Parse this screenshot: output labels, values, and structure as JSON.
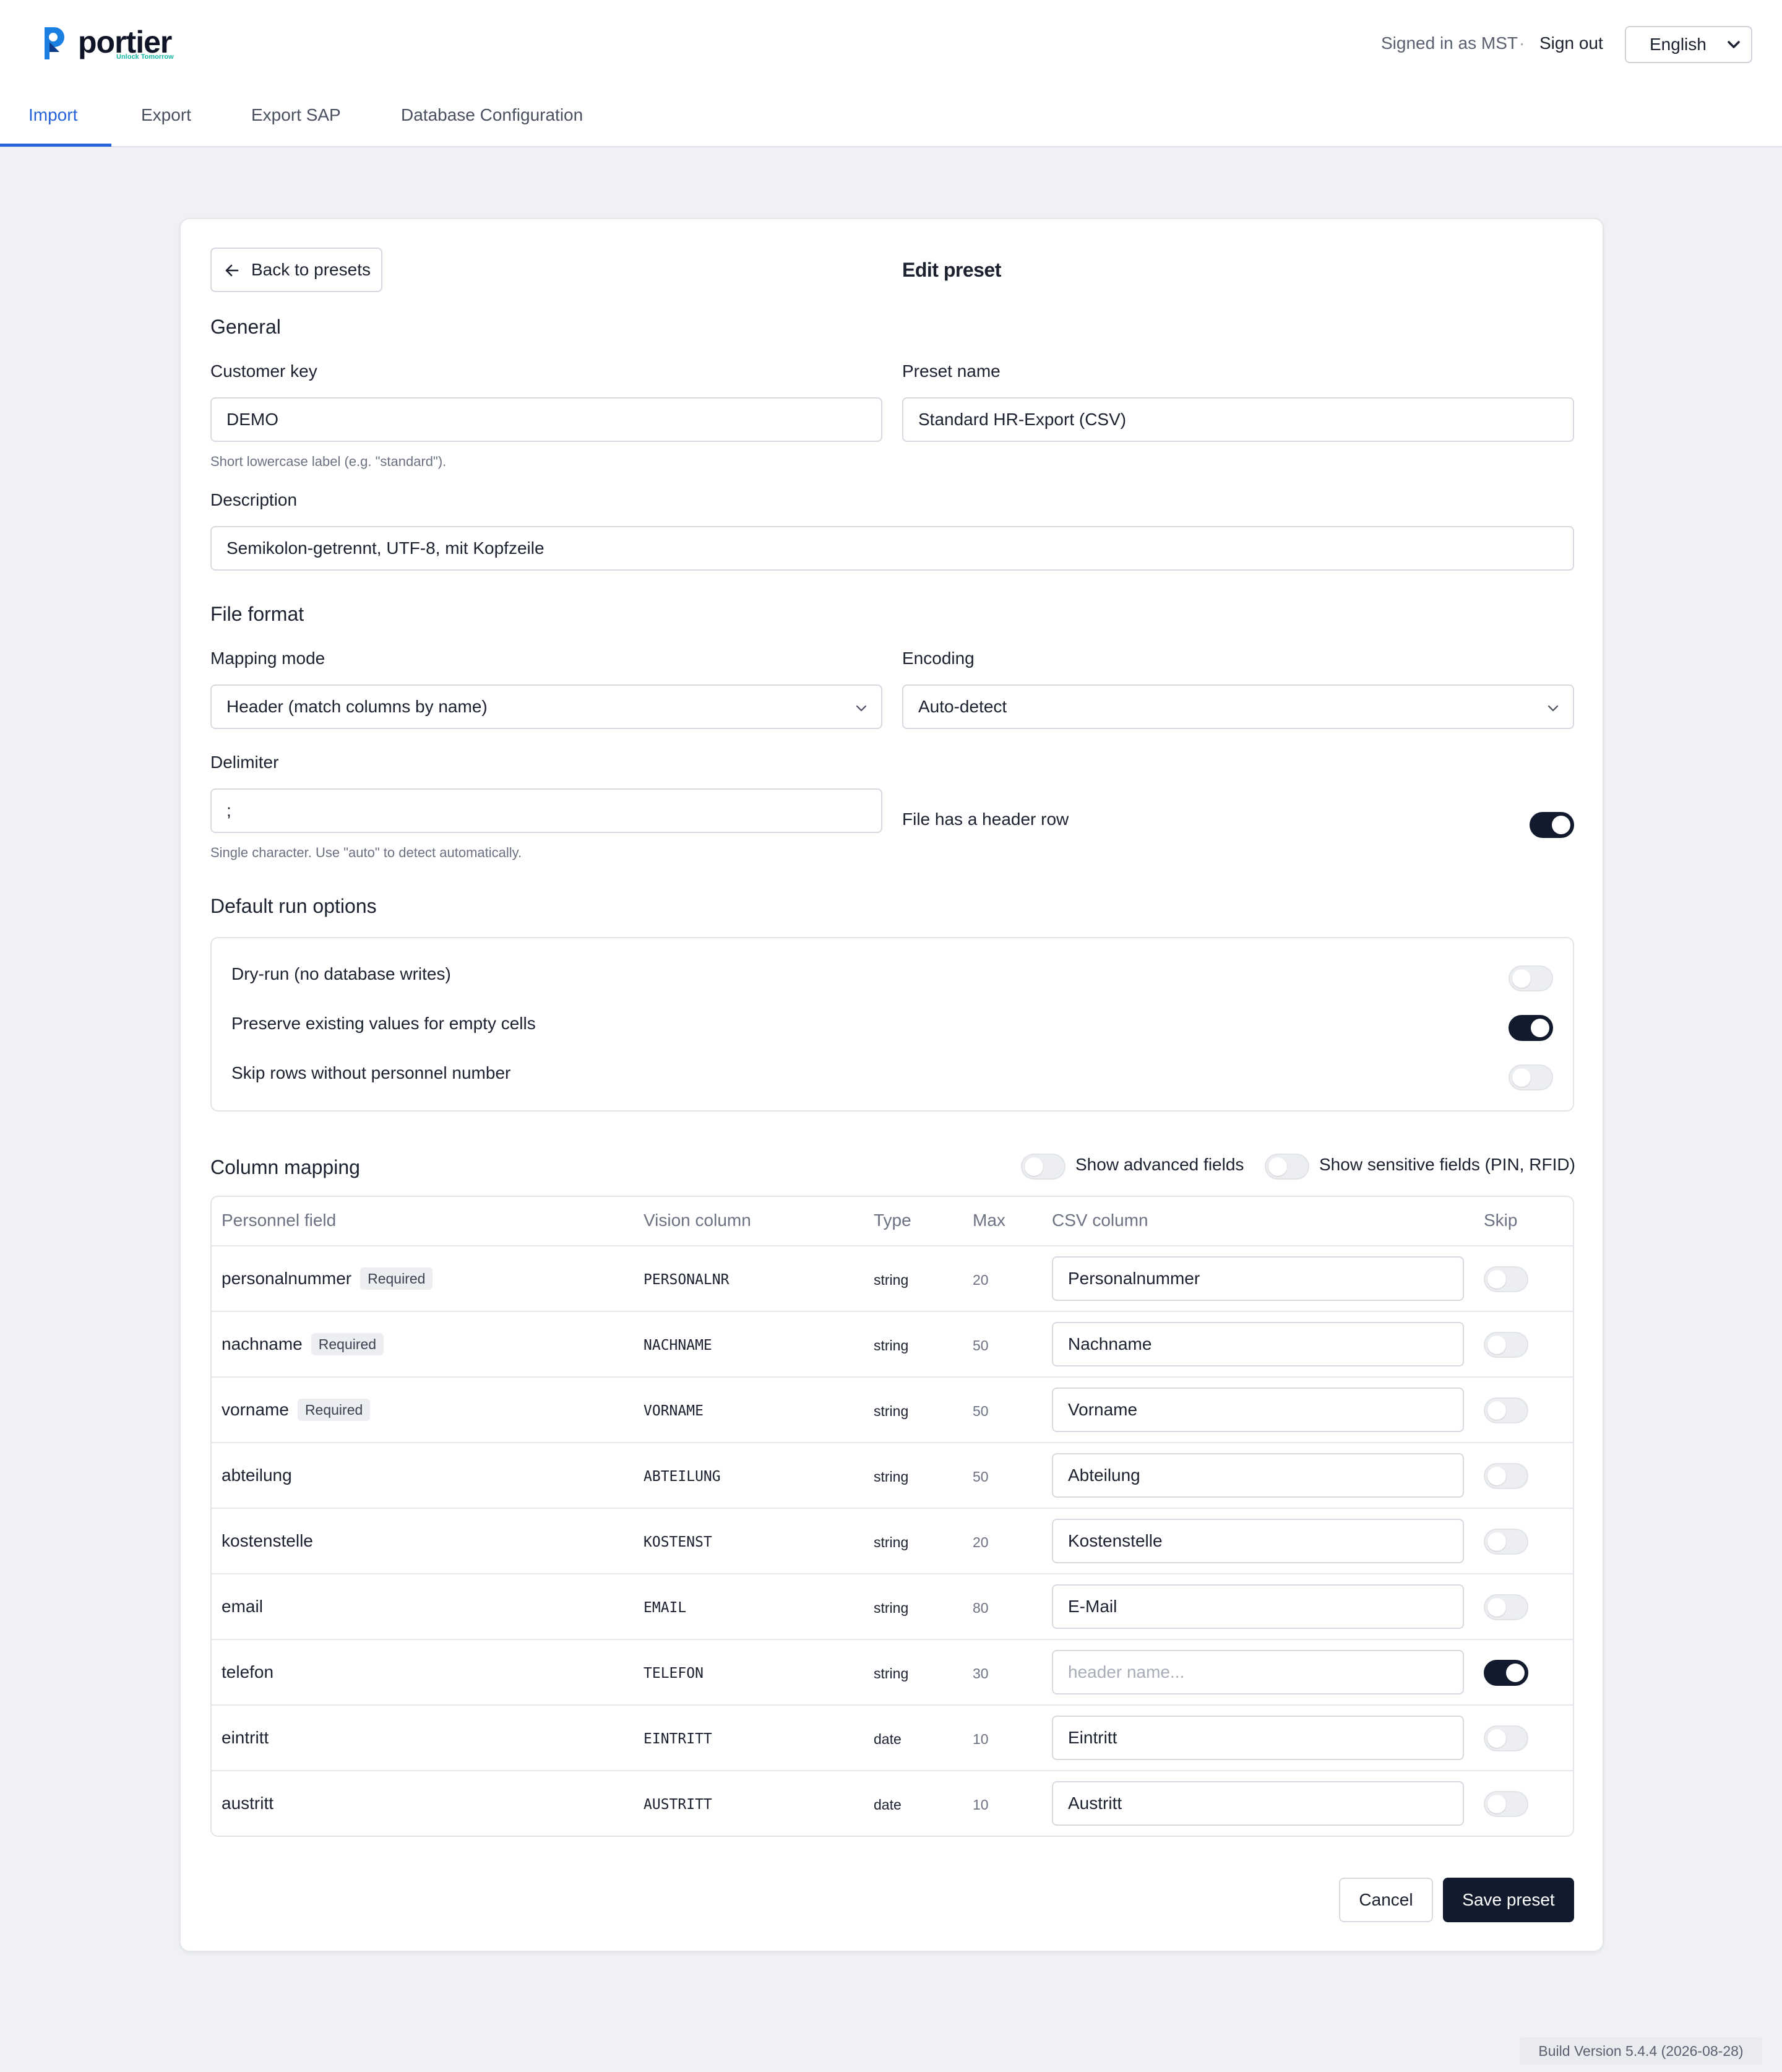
{
  "brand": {
    "name": "portier",
    "tagline": "Unlock Tomorrow",
    "primary_color": "#2563d8",
    "logo_colors": [
      "#1a7fe0",
      "#19b6a7"
    ]
  },
  "header": {
    "signed_in": "Signed in as MST",
    "separator": "·",
    "sign_out": "Sign out",
    "language": "English"
  },
  "tabs": [
    {
      "label": "Import",
      "active": true
    },
    {
      "label": "Export"
    },
    {
      "label": "Export SAP"
    },
    {
      "label": "Database Configuration"
    }
  ],
  "editor": {
    "back_label": "Back to presets",
    "title": "Edit preset",
    "general": {
      "title": "General",
      "customer_key_label": "Customer key",
      "customer_key_value": "DEMO",
      "customer_key_help": "Short lowercase label (e.g. \"standard\").",
      "preset_name_label": "Preset name",
      "preset_name_value": "Standard HR-Export (CSV)",
      "description_label": "Description",
      "description_value": "Semikolon-getrennt, UTF-8, mit Kopfzeile"
    },
    "file_format": {
      "title": "File format",
      "mapping_mode_label": "Mapping mode",
      "mapping_mode_value": "Header (match columns by name)",
      "encoding_label": "Encoding",
      "encoding_value": "Auto-detect",
      "delimiter_label": "Delimiter",
      "delimiter_value": ";",
      "delimiter_help": "Single character. Use \"auto\" to detect automatically.",
      "header_row_label": "File has a header row",
      "header_row_on": true
    },
    "run_options": {
      "title": "Default run options",
      "options": [
        {
          "label": "Dry-run (no database writes)",
          "on": false
        },
        {
          "label": "Preserve existing values for empty cells",
          "on": true
        },
        {
          "label": "Skip rows without personnel number",
          "on": false
        }
      ]
    },
    "column_mapping": {
      "title": "Column mapping",
      "show_advanced_label": "Show advanced fields",
      "show_advanced_on": false,
      "show_sensitive_label": "Show sensitive fields (PIN, RFID)",
      "show_sensitive_on": false,
      "headers": {
        "field": "Personnel field",
        "vision": "Vision column",
        "type": "Type",
        "max": "Max",
        "csv": "CSV column",
        "skip": "Skip"
      },
      "required_badge": "Required",
      "csv_placeholder": "header name...",
      "rows": [
        {
          "field": "personalnummer",
          "required": true,
          "vision": "PERSONALNR",
          "type": "string",
          "max": "20",
          "csv": "Personalnummer",
          "skip": false
        },
        {
          "field": "nachname",
          "required": true,
          "vision": "NACHNAME",
          "type": "string",
          "max": "50",
          "csv": "Nachname",
          "skip": false
        },
        {
          "field": "vorname",
          "required": true,
          "vision": "VORNAME",
          "type": "string",
          "max": "50",
          "csv": "Vorname",
          "skip": false
        },
        {
          "field": "abteilung",
          "required": false,
          "vision": "ABTEILUNG",
          "type": "string",
          "max": "50",
          "csv": "Abteilung",
          "skip": false
        },
        {
          "field": "kostenstelle",
          "required": false,
          "vision": "KOSTENST",
          "type": "string",
          "max": "20",
          "csv": "Kostenstelle",
          "skip": false
        },
        {
          "field": "email",
          "required": false,
          "vision": "EMAIL",
          "type": "string",
          "max": "80",
          "csv": "E-Mail",
          "skip": false
        },
        {
          "field": "telefon",
          "required": false,
          "vision": "TELEFON",
          "type": "string",
          "max": "30",
          "csv": "",
          "skip": true
        },
        {
          "field": "eintritt",
          "required": false,
          "vision": "EINTRITT",
          "type": "date",
          "max": "10",
          "csv": "Eintritt",
          "skip": false
        },
        {
          "field": "austritt",
          "required": false,
          "vision": "AUSTRITT",
          "type": "date",
          "max": "10",
          "csv": "Austritt",
          "skip": false
        }
      ]
    },
    "actions": {
      "cancel": "Cancel",
      "save": "Save preset"
    }
  },
  "footer": {
    "build": "Build Version 5.4.4 (2026-08-28)"
  }
}
